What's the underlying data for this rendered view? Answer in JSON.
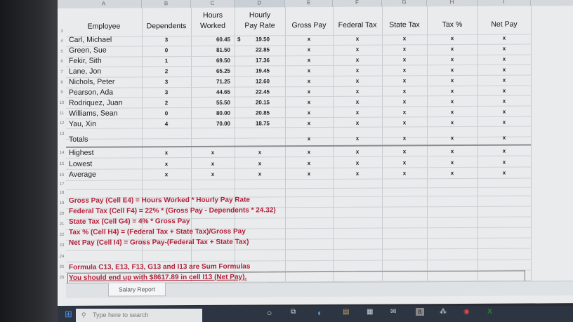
{
  "columns": [
    "A",
    "B",
    "C",
    "D",
    "E",
    "F",
    "G",
    "H",
    "I"
  ],
  "headers": {
    "employee": "Employee",
    "dependents": "Dependents",
    "hours_worked": "Hours Worked",
    "hourly_pay_rate": "Hourly Pay Rate",
    "gross_pay": "Gross Pay",
    "federal_tax": "Federal Tax",
    "state_tax": "State Tax",
    "tax_pct": "Tax %",
    "net_pay": "Net Pay"
  },
  "employees": [
    {
      "name": "Carl, Michael",
      "dependents": "3",
      "hours": "60.45",
      "dollar": "$",
      "rate": "19.50"
    },
    {
      "name": "Green, Sue",
      "dependents": "0",
      "hours": "81.50",
      "dollar": "",
      "rate": "22.85"
    },
    {
      "name": "Fekir, Sith",
      "dependents": "1",
      "hours": "69.50",
      "dollar": "",
      "rate": "17.36"
    },
    {
      "name": "Lane, Jon",
      "dependents": "2",
      "hours": "65.25",
      "dollar": "",
      "rate": "19.45"
    },
    {
      "name": "Nichols, Peter",
      "dependents": "3",
      "hours": "71.25",
      "dollar": "",
      "rate": "12.60"
    },
    {
      "name": "Pearson, Ada",
      "dependents": "3",
      "hours": "44.65",
      "dollar": "",
      "rate": "22.45"
    },
    {
      "name": "Rodriquez, Juan",
      "dependents": "2",
      "hours": "55.50",
      "dollar": "",
      "rate": "20.15"
    },
    {
      "name": "Williams, Sean",
      "dependents": "0",
      "hours": "80.00",
      "dollar": "",
      "rate": "20.85"
    },
    {
      "name": "Yau, Xin",
      "dependents": "4",
      "hours": "70.00",
      "dollar": "",
      "rate": "18.75"
    }
  ],
  "placeholder": "x",
  "totals_label": "Totals",
  "summary": [
    {
      "label": "Highest"
    },
    {
      "label": "Lowest"
    },
    {
      "label": "Average"
    }
  ],
  "notes": [
    "Gross Pay (Cell E4) = Hours Worked * Hourly Pay Rate",
    "Federal Tax (Cell F4) = 22% * (Gross Pay - Dependents * 24.32)",
    "State Tax (Cell G4) = 4% * Gross Pay",
    "Tax % (Cell H4) = (Federal Tax + State Tax)/Gross Pay",
    "Net Pay (Cell I4) = Gross Pay-(Federal Tax + State Tax)"
  ],
  "footer_note": "Formula C13, E13, F13, G13 and I13 are Sum Formulas",
  "target_note": "You should end up with $8617.89 in cell I13 (Net Pay).",
  "sheet_tab": "Salary Report",
  "taskbar": {
    "search_placeholder": "Type here to search"
  },
  "row_numbers": [
    "3",
    "4",
    "5",
    "6",
    "7",
    "8",
    "9",
    "10",
    "11",
    "12",
    "13",
    "14",
    "15",
    "16",
    "17",
    "18",
    "19",
    "20",
    "21",
    "22",
    "23",
    "24",
    "25",
    "26"
  ]
}
